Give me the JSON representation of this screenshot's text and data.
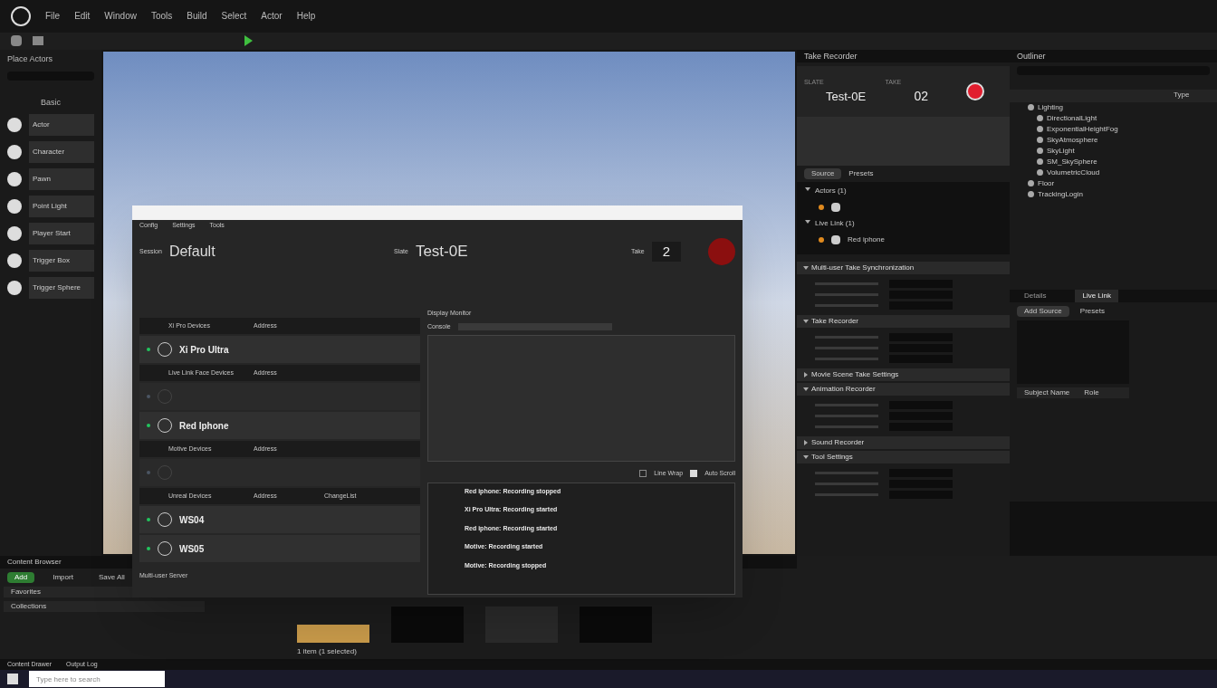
{
  "menu": [
    "File",
    "Edit",
    "Window",
    "Tools",
    "Build",
    "Select",
    "Actor",
    "Help"
  ],
  "place_actors": {
    "title": "Place Actors",
    "category": "Basic",
    "items": [
      "Actor",
      "Character",
      "Pawn",
      "Point Light",
      "Player Start",
      "Trigger Box",
      "Trigger Sphere"
    ]
  },
  "dialog": {
    "menu": [
      "Config",
      "Settings",
      "Tools"
    ],
    "session_label": "Session",
    "session": "Default",
    "slate_label": "Slate",
    "slate": "Test-0E",
    "take_label": "Take",
    "take": "2",
    "recording": true,
    "groups": [
      {
        "header": "Xi Pro Devices",
        "column": "Address",
        "devices": [
          {
            "name": "Xi Pro Ultra",
            "enabled": true,
            "color": "#22c55e"
          }
        ]
      },
      {
        "header": "Live Link Face Devices",
        "column": "Address",
        "devices": [
          {
            "enabled": false,
            "color": "#4b5563"
          },
          {
            "name": "Red Iphone",
            "enabled": true,
            "color": "#22c55e"
          }
        ]
      },
      {
        "header": "Motive Devices",
        "column": "Address",
        "devices": [
          {
            "enabled": false,
            "color": "#4b5563"
          }
        ]
      },
      {
        "header": "Unreal Devices",
        "column": "Address",
        "extra_column": "ChangeList",
        "devices": [
          {
            "name": "WS04",
            "enabled": true,
            "color": "#22c55e"
          },
          {
            "name": "WS05",
            "enabled": true,
            "color": "#22c55e"
          }
        ]
      }
    ],
    "monitor_tab": "Display Monitor",
    "console_label": "Console",
    "log": [
      {
        "kind": "heading",
        "text": "Red iphone: Recording stopped"
      },
      {
        "kind": "heading",
        "text": "Xi Pro Ultra: Recording started"
      },
      {
        "kind": "heading",
        "text": "Red iphone: Recording started"
      },
      {
        "kind": "heading",
        "text": "Motive: Recording started"
      },
      {
        "kind": "heading",
        "text": "Motive: Recording stopped"
      }
    ],
    "line_wrap": {
      "label": "Line Wrap",
      "checked": false
    },
    "auto_scroll": {
      "label": "Auto Scroll",
      "checked": true
    },
    "multi_user_label": "Multi-user Server"
  },
  "take_recorder": {
    "tab": "Take Recorder",
    "slate_label": "SLATE",
    "take_label": "TAKE",
    "slate": "Test-0E",
    "take": "02",
    "recording": true,
    "source_button": "Source",
    "presets": "Presets",
    "sources": [
      {
        "label": "Actors (1)",
        "expanded": true
      },
      {
        "label": "Live Link (1)",
        "expanded": true,
        "child": "Red iphone"
      }
    ],
    "sections": [
      {
        "label": "Multi-user Take Synchronization",
        "expanded": true
      },
      {
        "label": "Take Recorder",
        "expanded": true
      },
      {
        "label": "Movie Scene Take Settings",
        "expanded": false
      },
      {
        "label": "Animation Recorder",
        "expanded": true
      },
      {
        "label": "Sound Recorder",
        "expanded": false
      },
      {
        "label": "Tool Settings",
        "expanded": true
      }
    ]
  },
  "outliner": {
    "tab": "Outliner",
    "type_column": "Type",
    "tree": [
      {
        "label": "Lighting",
        "children": [
          {
            "label": "DirectionalLight"
          },
          {
            "label": "ExponentialHeightFog"
          },
          {
            "label": "SkyAtmosphere"
          },
          {
            "label": "SkyLight"
          },
          {
            "label": "SM_SkySphere"
          },
          {
            "label": "VolumetricCloud"
          }
        ]
      },
      {
        "label": "Floor"
      },
      {
        "label": "TrackingLogin"
      }
    ]
  },
  "live_link": {
    "tabs": [
      {
        "label": "Details",
        "selected": false
      },
      {
        "label": "Live Link",
        "selected": true
      }
    ],
    "add_source": "Add Source",
    "presets": "Presets",
    "subject_header": "Subject Name",
    "role_header": "Role"
  },
  "content_browser": {
    "tab": "Content Browser",
    "add": "Add",
    "import": "Import",
    "save_all": "Save All",
    "folders": [
      {
        "label": "Favorites",
        "selected": false
      },
      {
        "label": "Collections",
        "selected": false
      }
    ],
    "status": "1 item (1 selected)"
  },
  "bottom_tabs": [
    "Content Drawer",
    "Output Log"
  ],
  "taskbar": {
    "search_placeholder": "Type here to search"
  }
}
